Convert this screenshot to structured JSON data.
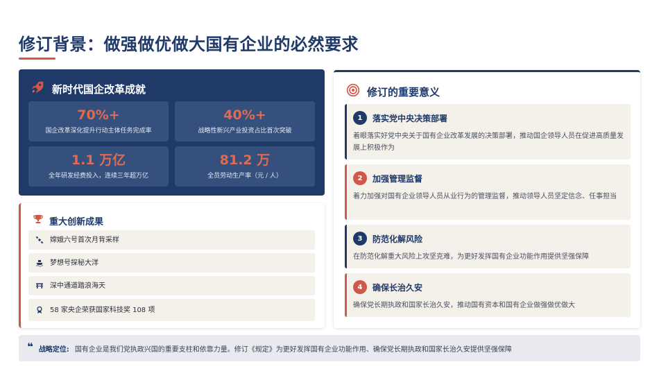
{
  "page": {
    "title": "修订背景：做强做优做大国有企业的必然要求"
  },
  "achievements": {
    "title": "新时代国企改革成就",
    "icon": "rocket-icon",
    "stats": [
      {
        "value": "70%+",
        "label": "国企改革深化提升行动主体任务完成率"
      },
      {
        "value": "40%+",
        "label": "战略性新兴产业投资占比首次突破"
      },
      {
        "value": "1.1 万亿",
        "label": "全年研发经费投入，连续三年超万亿"
      },
      {
        "value": "81.2 万",
        "label": "全员劳动生产率（元 / 人）"
      }
    ]
  },
  "innovations": {
    "title": "重大创新成果",
    "icon": "trophy-icon",
    "items": [
      {
        "text": "嫦娥六号首次月背采样",
        "icon": "satellite-icon"
      },
      {
        "text": "梦想号探秘大洋",
        "icon": "ship-icon"
      },
      {
        "text": "深中通道踏浪海天",
        "icon": "bridge-icon"
      },
      {
        "text": "58 家央企荣获国家科技奖 108 项",
        "icon": "award-icon"
      }
    ]
  },
  "significance": {
    "title": "修订的重要意义",
    "icon": "target-icon",
    "items": [
      {
        "num": "1",
        "title": "落实党中央决策部署",
        "desc": "着眼落实好党中央关于国有企业改革发展的决策部署，推动国企领导人员在促进高质量发展上积极作为"
      },
      {
        "num": "2",
        "title": "加强管理监督",
        "desc": "着力加强对国有企业领导人员从业行为的管理监督，推动领导人员坚定信念、任事担当"
      },
      {
        "num": "3",
        "title": "防范化解风险",
        "desc": "在防范化解重大风险上攻坚克难，为更好发挥国有企业功能作用提供坚强保障"
      },
      {
        "num": "4",
        "title": "确保长治久安",
        "desc": "确保党长期执政和国家长治久安，推动国有资本和国有企业做强做优做大"
      }
    ]
  },
  "strategy": {
    "icon": "quote-icon",
    "label": "战略定位:",
    "text": "国有企业是我们党执政兴国的重要支柱和依靠力量。修订《规定》为更好发挥国有企业功能作用、确保党长期执政和国家长治久安提供坚强保障"
  },
  "colors": {
    "navy": "#1f3a68",
    "accent_red": "#d0584a",
    "stat_value": "#e26a53",
    "card_bg": "#f4f0ea"
  }
}
